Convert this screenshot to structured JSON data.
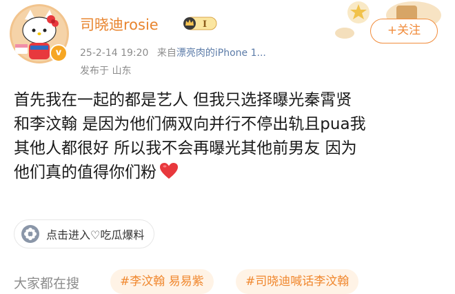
{
  "post": {
    "username": "司晓迪rosie",
    "vip_level": "I",
    "verified_mark": "v",
    "date": "25-2-14 19:20",
    "source_prefix": "来自",
    "source_device": "漂亮肉的iPhone 1...",
    "location": "发布于 山东",
    "follow_label": "+关注",
    "content_lines": [
      "首先我在一起的都是艺人 但我只选择曝光秦霄贤",
      "和李汶翰 是因为他们俩双向并行不停出轨且pua我",
      "其他人都很好 所以我不会再曝光其他前男友 因为",
      "他们真的值得你们粉"
    ],
    "content_emoji": "red-heart-icon",
    "topic_label": "点击进入♡吃瓜爆料",
    "topic_icon": "flower-icon"
  },
  "trending": {
    "label": "大家都在搜",
    "chips": [
      "#李汶翰 易易紫",
      "#司晓迪喊话李汶翰"
    ]
  },
  "colors": {
    "username": "#e8842e",
    "accent": "#f18b3a",
    "chip_bg": "#fff3e6",
    "meta_text": "#8c8c8c",
    "link": "#5b7ba8",
    "heart": "#e8383d"
  }
}
